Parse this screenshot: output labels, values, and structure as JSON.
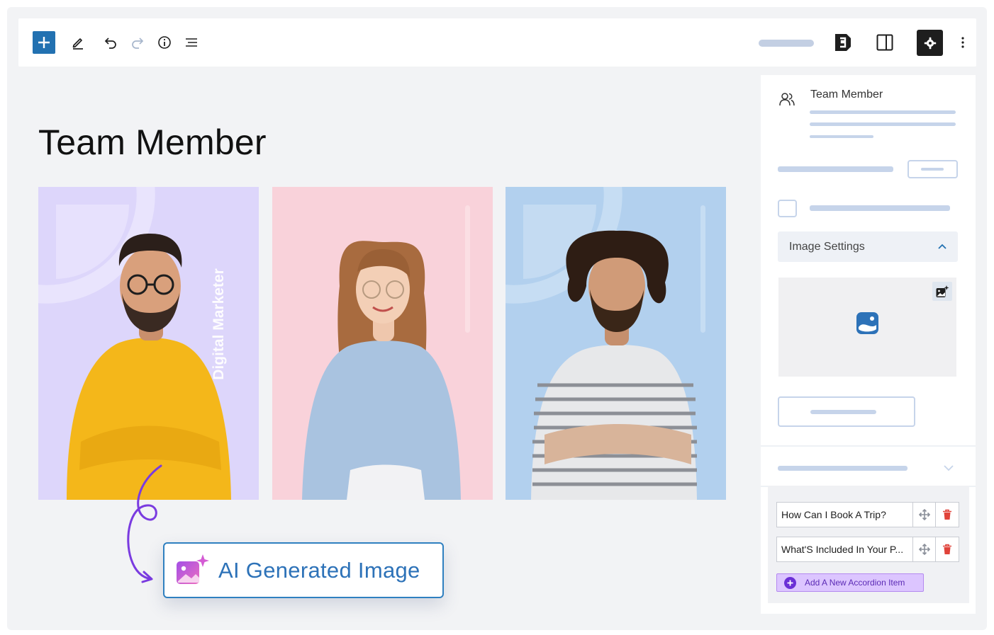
{
  "toolbar": {
    "icons": [
      "plus-icon",
      "pencil-icon",
      "undo-icon",
      "redo-icon",
      "info-icon",
      "list-view-icon",
      "brand-logo-icon",
      "sidebar-toggle-icon",
      "gear-icon",
      "more-vertical-icon"
    ]
  },
  "canvas": {
    "title": "Team Member",
    "cards": [
      {
        "role": "Digital Marketer",
        "color": "#ddd6fb"
      },
      {
        "role": "",
        "color": "#f9d2da"
      },
      {
        "role": "",
        "color": "#b2d0ee"
      }
    ],
    "ai_badge": {
      "label": "AI Generated Image",
      "icon": "ai-image-sparkle-icon"
    }
  },
  "sidebar": {
    "block_title": "Team Member",
    "block_icon": "users-icon",
    "image_settings": {
      "label": "Image Settings",
      "chevron": "chevron-up-icon"
    },
    "image_placeholder_icon": "image-icon",
    "ai_image_button_icon": "ai-image-icon",
    "repeater": {
      "items": [
        {
          "label": "How Can I Book A Trip?"
        },
        {
          "label": "What'S Included In Your P..."
        }
      ],
      "add_label": "Add A New Accordion Item"
    }
  },
  "colors": {
    "accent_blue": "#2271b1",
    "ai_blue": "#2d72b8",
    "purple": "#6b2fd6",
    "delete_red": "#e0433a"
  }
}
